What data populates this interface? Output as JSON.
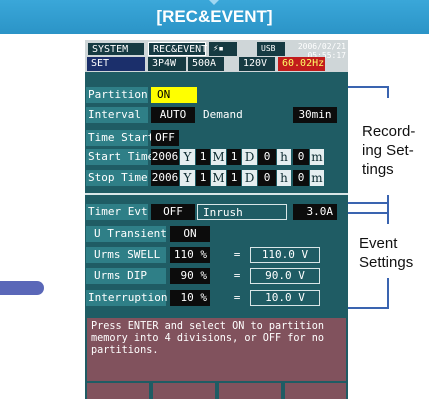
{
  "banner": {
    "title": "[REC&EVENT]"
  },
  "status": {
    "tab_system": "SYSTEM",
    "tab_recevent": "REC&EVENT",
    "tab_set": "SET",
    "wiring": "3P4W",
    "current": "500A",
    "voltage": "120V",
    "frequency": "60.02Hz",
    "usb": "USB",
    "date": "2006/02/21",
    "time": "05:55:17",
    "icons": [
      "plug-icon",
      "card-icon"
    ]
  },
  "recording": {
    "partition_label": "Partition",
    "partition_value": "ON",
    "interval_label": "Interval",
    "interval_value": "AUTO",
    "demand_label": "Demand",
    "demand_value": "30min",
    "time_start_label": "Time Start",
    "time_start_value": "OFF",
    "start_time_label": "Start Time",
    "stop_time_label": "Stop Time",
    "start": {
      "year": "2006",
      "month": "1",
      "day": "1",
      "hour": "0",
      "minute": "0"
    },
    "stop": {
      "year": "2006",
      "month": "1",
      "day": "1",
      "hour": "0",
      "minute": "0"
    },
    "units": {
      "year": "Y",
      "month": "M",
      "day": "D",
      "hour": "h",
      "minute": "m"
    }
  },
  "event": {
    "timer_evt_label": "Timer Evt",
    "timer_evt_value": "OFF",
    "inrush_label": "Inrush",
    "inrush_value": "3.0A",
    "u_transient_label": "U Transient",
    "u_transient_value": "ON",
    "swell_label": "Urms SWELL",
    "swell_value": "110 %",
    "swell_result": "110.0 V",
    "dip_label": "Urms DIP",
    "dip_value": "90 %",
    "dip_result": "90.0 V",
    "interruption_label": "Interruption",
    "interruption_value": "10 %",
    "interruption_result": "10.0 V",
    "equals": "="
  },
  "help_text": "Press ENTER and select ON to partition memory into 4 divisions, or OFF for no partitions.",
  "callouts": {
    "recording_line1": "Record-",
    "recording_line2": "ing Set-",
    "recording_line3": "tings",
    "event_line1": "Event",
    "event_line2": "Settings"
  },
  "colors": {
    "screen_bg": "#1f5c64",
    "highlight": "#ffff00",
    "help_bg": "#81525d",
    "banner_bg": "#3aa7d9"
  }
}
